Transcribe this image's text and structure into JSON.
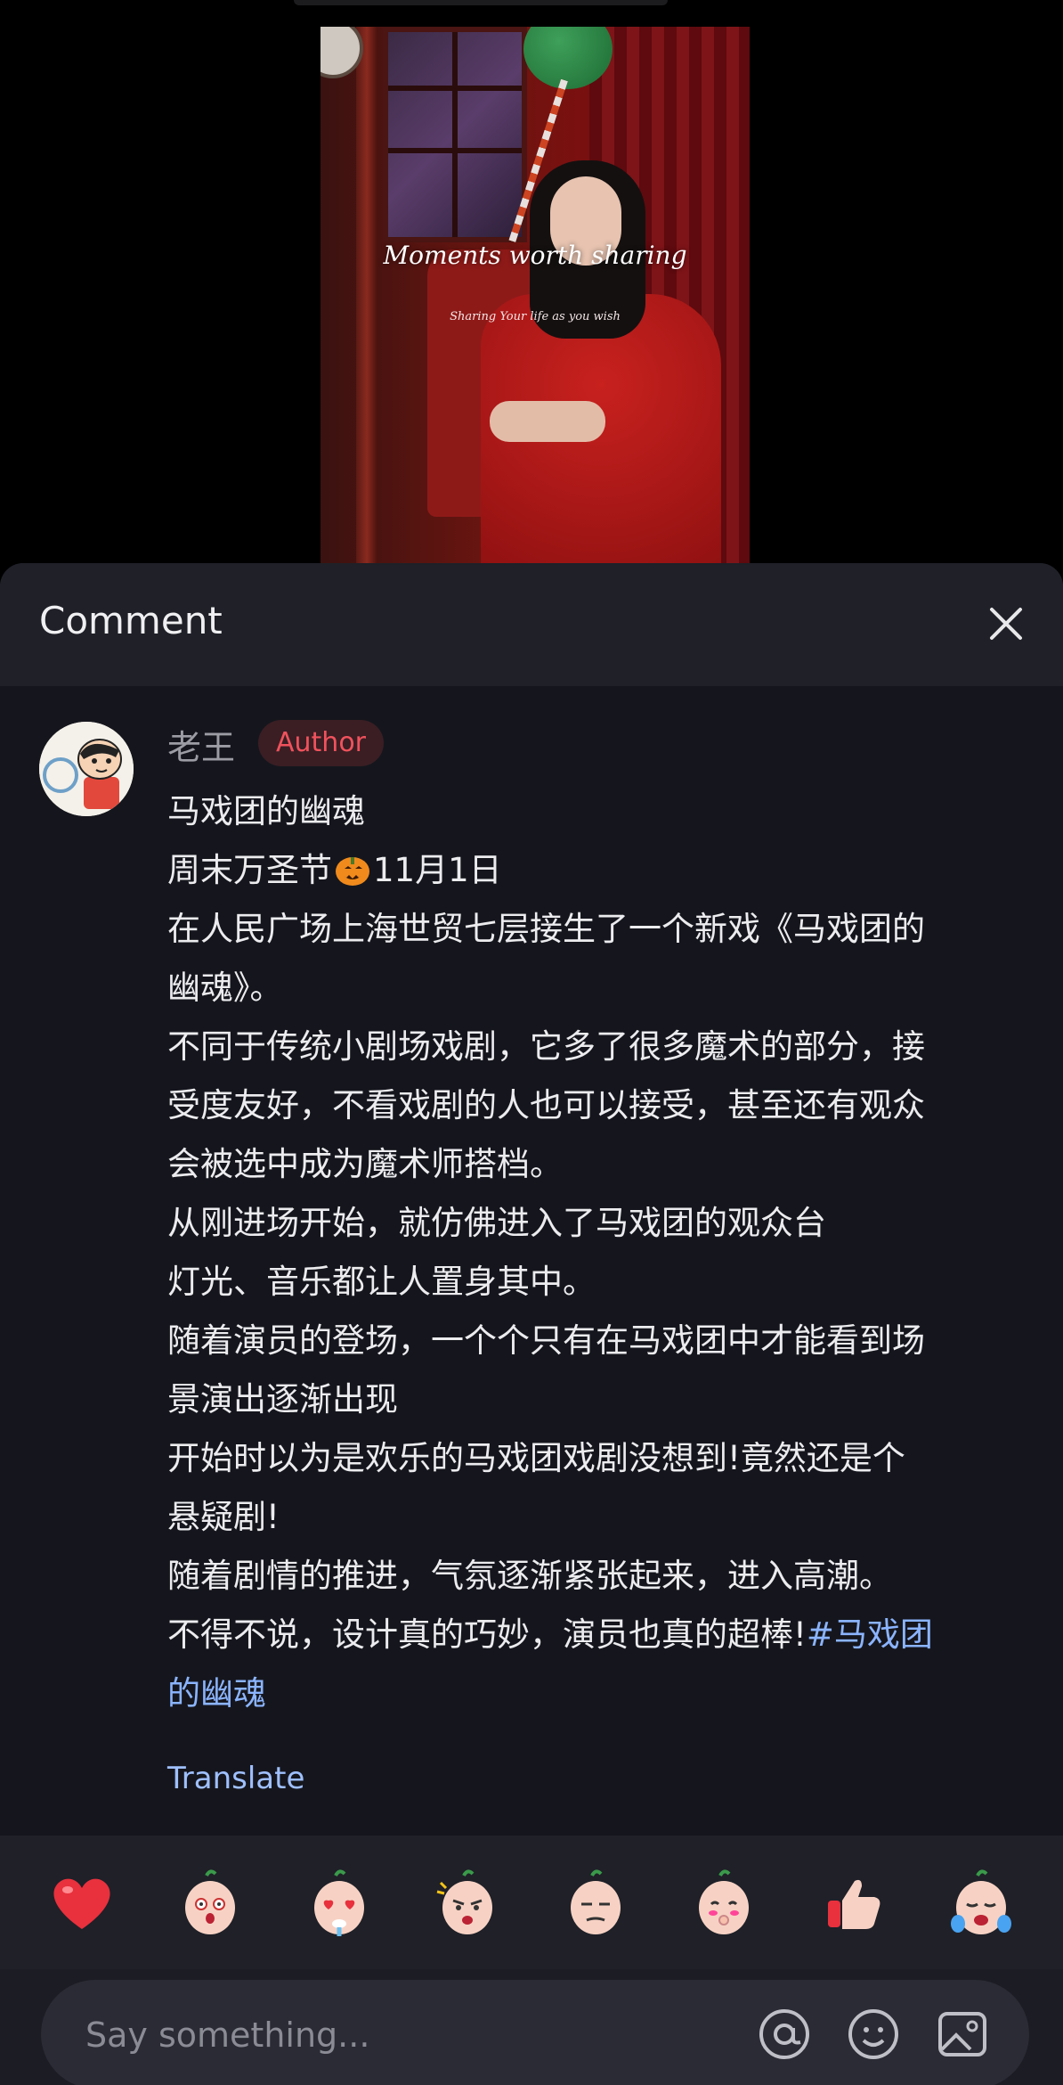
{
  "video": {
    "overlay_title": "Moments worth sharing",
    "overlay_subtitle": "Sharing Your life as you wish"
  },
  "sheet": {
    "title": "Comment",
    "close_icon": "close-icon"
  },
  "comment": {
    "username": "老王",
    "badge": "Author",
    "lines": [
      "马戏团的幽魂",
      "周末万圣节",
      "在人民广场上海世贸七层接生了一个新戏《马戏团的",
      "幽魂》。",
      "不同于传统小剧场戏剧，它多了很多魔术的部分，接",
      "受度友好，不看戏剧的人也可以接受，甚至还有观众",
      "会被选中成为魔术师搭档。",
      "从刚进场开始，就仿佛进入了马戏团的观众台",
      "灯光、音乐都让人置身其中。",
      "随着演员的登场，一个个只有在马戏团中才能看到场",
      "景演出逐渐出现",
      "开始时以为是欢乐的马戏团戏剧没想到!竟然还是个",
      "悬疑剧!",
      "随着剧情的推进，气氛逐渐紧张起来，进入高潮。",
      "不得不说，设计真的巧妙，演员也真的超棒!"
    ],
    "line2_date": "11月1日",
    "hashtag_part1": "#马戏团",
    "hashtag_part2": "的幽魂",
    "translate": "Translate"
  },
  "emojis": [
    "heart-emoji",
    "shocked-emoji",
    "heart-eyes-emoji",
    "angry-emoji",
    "smirk-emoji",
    "shy-emoji",
    "thumbs-up-emoji",
    "crying-emoji"
  ],
  "input": {
    "placeholder": "Say something...",
    "icons": [
      "at-icon",
      "smile-icon",
      "image-icon"
    ]
  },
  "colors": {
    "accent_badge": "#f0525c",
    "link": "#9fc0ff",
    "hashtag": "#8bb4ff",
    "sheet_bg": "#1b1c24"
  }
}
